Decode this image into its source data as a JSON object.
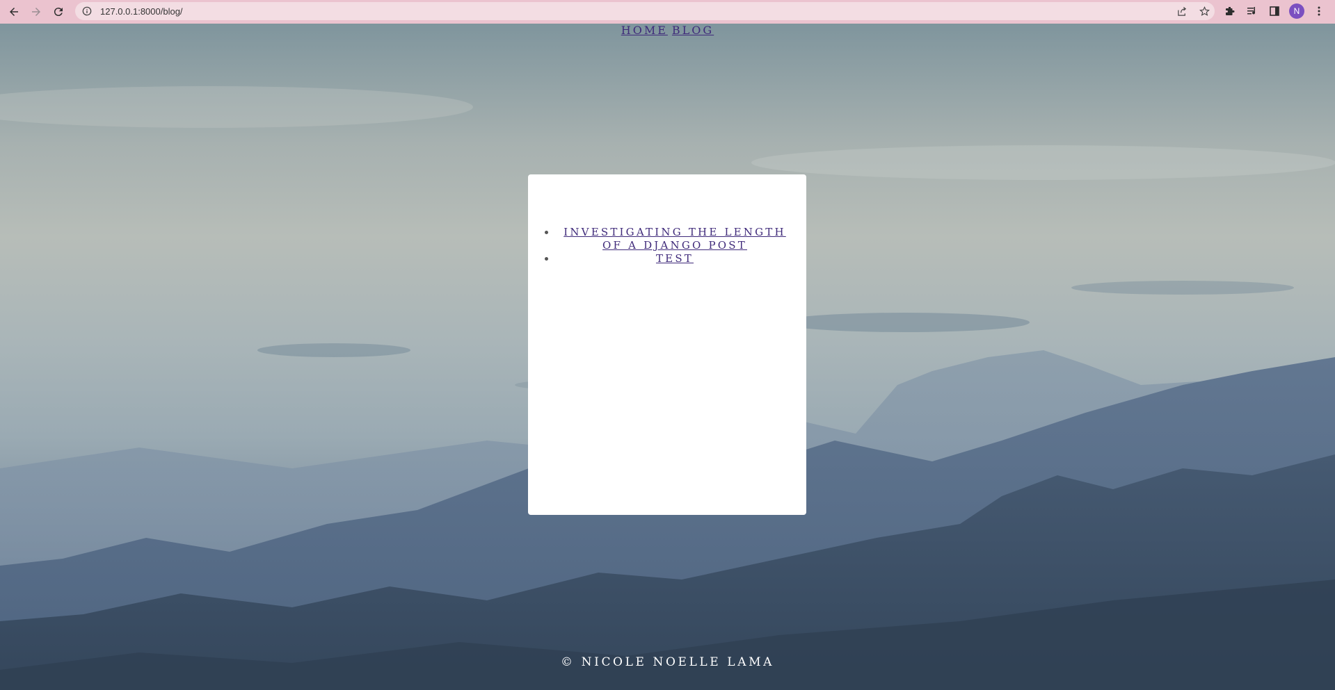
{
  "browser": {
    "url": "127.0.0.1:8000/blog/",
    "profile_initial": "N"
  },
  "nav": {
    "home_label": "HOME",
    "blog_label": "BLOG"
  },
  "posts": [
    {
      "title": "INVESTIGATING THE LENGTH OF A DJANGO POST"
    },
    {
      "title": "TEST"
    }
  ],
  "footer": {
    "text": "© NICOLE NOELLE LAMA"
  },
  "colors": {
    "chrome_bg": "#ebc3cf",
    "link": "#3f2a7a",
    "avatar": "#7b4fc0"
  }
}
